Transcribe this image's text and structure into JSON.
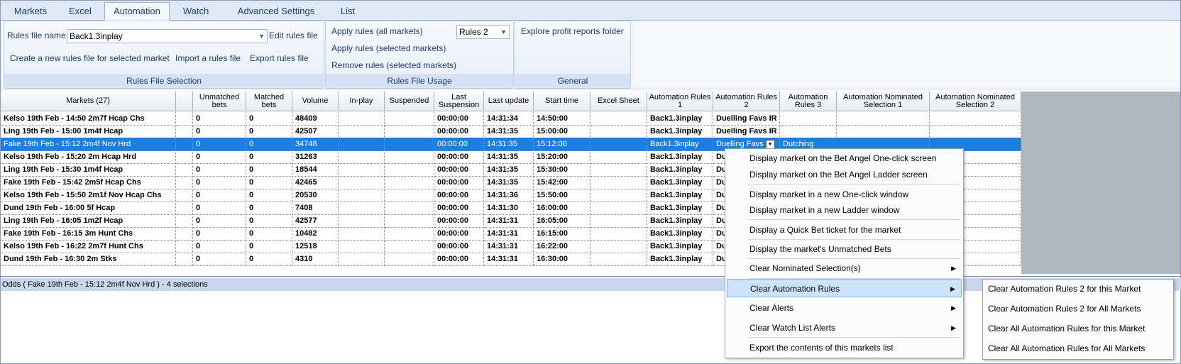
{
  "tabs": [
    "Markets",
    "Excel",
    "Automation",
    "Watch",
    "Advanced Settings",
    "List"
  ],
  "active_tab": "Automation",
  "ribbon": {
    "rules_file_selection": {
      "rules_file_label": "Rules file name",
      "rules_file_value": "Back1.3inplay",
      "edit_rules_file": "Edit rules file",
      "create_new": "Create a new rules file for selected market",
      "import": "Import a rules file",
      "export": "Export rules file",
      "group_label": "Rules File Selection"
    },
    "rules_file_usage": {
      "apply_all": "Apply rules (all markets)",
      "rules_combo": "Rules 2",
      "apply_selected": "Apply rules (selected markets)",
      "remove_selected": "Remove rules (selected markets)",
      "group_label": "Rules File Usage"
    },
    "general": {
      "explore": "Explore profit reports folder",
      "group_label": "General"
    }
  },
  "grid": {
    "headers": {
      "markets": "Markets (27)",
      "unmatched": "Unmatched bets",
      "matched": "Matched bets",
      "volume": "Volume",
      "inplay": "In-play",
      "suspended": "Suspended",
      "last_suspension": "Last Suspension",
      "last_update": "Last update",
      "start_time": "Start time",
      "excel_sheet": "Excel Sheet",
      "auto1": "Automation Rules 1",
      "auto2": "Automation Rules 2",
      "auto3": "Automation Rules 3",
      "nom1": "Automation Nominated Selection 1",
      "nom2": "Automation Nominated Selection 2"
    },
    "rows": [
      {
        "market": "Kelso 19th Feb - 14:50 2m7f Hcap Chs",
        "unmatched": "0",
        "matched": "0",
        "volume": "48409",
        "last_suspension": "00:00:00",
        "last_update": "14:31:34",
        "start_time": "14:50:00",
        "auto1": "Back1.3inplay",
        "auto2": "Duelling Favs IR",
        "auto3": ""
      },
      {
        "market": "Ling 19th Feb - 15:00 1m4f Hcap",
        "unmatched": "0",
        "matched": "0",
        "volume": "42507",
        "last_suspension": "00:00:00",
        "last_update": "14:31:35",
        "start_time": "15:00:00",
        "auto1": "Back1.3inplay",
        "auto2": "Duelling Favs IR",
        "auto3": ""
      },
      {
        "market": "Fake  19th Feb - 15:12 2m4f Nov Hrd",
        "unmatched": "0",
        "matched": "0",
        "volume": "34748",
        "last_suspension": "00:00:00",
        "last_update": "14:31:35",
        "start_time": "15:12:00",
        "auto1": "Back1.3inplay",
        "auto2": "Duelling Favs",
        "auto3": "Dutching"
      },
      {
        "market": "Kelso 19th Feb - 15:20 2m Hcap Hrd",
        "unmatched": "0",
        "matched": "0",
        "volume": "31263",
        "last_suspension": "00:00:00",
        "last_update": "14:31:35",
        "start_time": "15:20:00",
        "auto1": "Back1.3inplay",
        "auto2": "Du",
        "auto3": ""
      },
      {
        "market": "Ling 19th Feb - 15:30 1m4f Hcap",
        "unmatched": "0",
        "matched": "0",
        "volume": "18544",
        "last_suspension": "00:00:00",
        "last_update": "14:31:35",
        "start_time": "15:30:00",
        "auto1": "Back1.3inplay",
        "auto2": "Du",
        "auto3": ""
      },
      {
        "market": "Fake  19th Feb - 15:42 2m5f Hcap Chs",
        "unmatched": "0",
        "matched": "0",
        "volume": "42465",
        "last_suspension": "00:00:00",
        "last_update": "14:31:35",
        "start_time": "15:42:00",
        "auto1": "Back1.3inplay",
        "auto2": "Du",
        "auto3": ""
      },
      {
        "market": "Kelso 19th Feb - 15:50 2m1f Nov Hcap Chs",
        "unmatched": "0",
        "matched": "0",
        "volume": "20530",
        "last_suspension": "00:00:00",
        "last_update": "14:31:36",
        "start_time": "15:50:00",
        "auto1": "Back1.3inplay",
        "auto2": "Du",
        "auto3": ""
      },
      {
        "market": "Dund 19th Feb - 16:00 5f Hcap",
        "unmatched": "0",
        "matched": "0",
        "volume": "7408",
        "last_suspension": "00:00:00",
        "last_update": "14:31:30",
        "start_time": "16:00:00",
        "auto1": "Back1.3inplay",
        "auto2": "Du",
        "auto3": ""
      },
      {
        "market": "Ling 19th Feb - 16:05 1m2f Hcap",
        "unmatched": "0",
        "matched": "0",
        "volume": "42577",
        "last_suspension": "00:00:00",
        "last_update": "14:31:31",
        "start_time": "16:05:00",
        "auto1": "Back1.3inplay",
        "auto2": "Du",
        "auto3": ""
      },
      {
        "market": "Fake  19th Feb - 16:15 3m Hunt Chs",
        "unmatched": "0",
        "matched": "0",
        "volume": "10482",
        "last_suspension": "00:00:00",
        "last_update": "14:31:31",
        "start_time": "16:15:00",
        "auto1": "Back1.3inplay",
        "auto2": "Du",
        "auto3": ""
      },
      {
        "market": "Kelso 19th Feb - 16:22 2m7f Hunt Chs",
        "unmatched": "0",
        "matched": "0",
        "volume": "12518",
        "last_suspension": "00:00:00",
        "last_update": "14:31:31",
        "start_time": "16:22:00",
        "auto1": "Back1.3inplay",
        "auto2": "Du",
        "auto3": ""
      },
      {
        "market": "Dund 19th Feb - 16:30 2m Stks",
        "unmatched": "0",
        "matched": "0",
        "volume": "4310",
        "last_suspension": "00:00:00",
        "last_update": "14:31:31",
        "start_time": "16:30:00",
        "auto1": "Back1.3inplay",
        "auto2": "Du",
        "auto3": ""
      }
    ]
  },
  "status_text": "Odds ( Fake  19th Feb - 15:12 2m4f Nov Hrd ) - 4 selections",
  "context_menu": {
    "items": [
      "Display market on the Bet Angel One-click screen",
      "Display market on the Bet Angel Ladder screen",
      "Display market in a new One-click window",
      "Display market in a new Ladder window",
      "Display a Quick Bet ticket for the market",
      "Display the market's Unmatched Bets",
      "Clear Nominated Selection(s)",
      "Clear Automation Rules",
      "Clear Alerts",
      "Clear Watch List Alerts",
      "Export the contents of this markets list"
    ]
  },
  "submenu": {
    "items": [
      "Clear Automation Rules 2 for this Market",
      "Clear Automation Rules 2 for All Markets",
      "Clear All Automation Rules for this Market",
      "Clear All Automation Rules for All Markets"
    ]
  },
  "colors": {
    "selection": "#1a7fe0",
    "menu_highlight": "#cde3fb",
    "ribbon_text": "#1e3b6e"
  }
}
